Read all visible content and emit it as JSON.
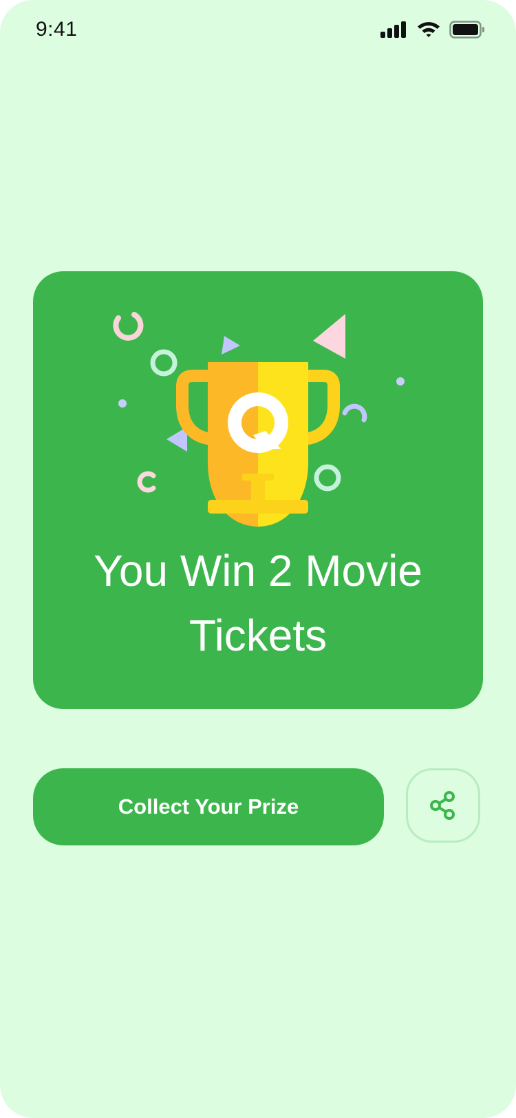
{
  "status_bar": {
    "time": "9:41",
    "icons": [
      "signal-icon",
      "wifi-icon",
      "battery-icon"
    ]
  },
  "prize_card": {
    "illustration": "trophy-icon",
    "headline": "You Win 2 Movie Tickets"
  },
  "actions": {
    "collect_label": "Collect Your Prize",
    "share_icon": "share-icon"
  },
  "colors": {
    "background": "#dcfde0",
    "accent": "#3cb64c",
    "trophy_gold": "#fdd21b",
    "trophy_orange": "#fdb827",
    "share_border": "#b8ecc0"
  }
}
